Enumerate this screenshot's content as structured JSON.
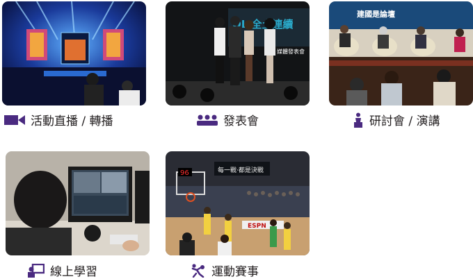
{
  "services": [
    {
      "label": "活動直播 / 轉播",
      "icon": "video-camera-icon"
    },
    {
      "label": "發表會",
      "icon": "audience-icon"
    },
    {
      "label": "研討會 / 演講",
      "icon": "speaker-podium-icon"
    },
    {
      "label": "線上學習",
      "icon": "online-teacher-icon"
    },
    {
      "label": "運動賽事",
      "icon": "sports-icon"
    }
  ],
  "photo_texts": {
    "launch_banner": "OL 全土連續",
    "launch_sub": "媒體發表會",
    "forum_banner": "建國是論壇",
    "sports_banner": "每一戰‧都是決戰",
    "scoreboard": "96",
    "court_brand": "ESPN"
  },
  "accent_color": "#4a2a80"
}
